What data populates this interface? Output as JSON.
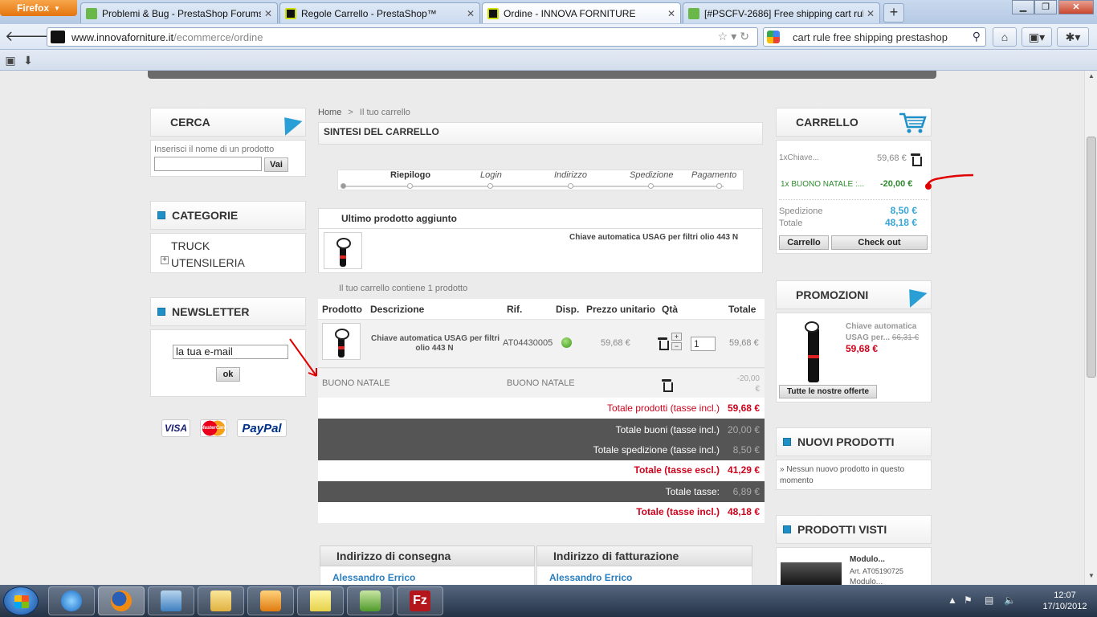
{
  "browser": {
    "menu_button": "Firefox",
    "tabs": [
      {
        "label": "Problemi & Bug - PrestaShop Forums",
        "icon": "prestashop-icon",
        "active": false
      },
      {
        "label": "Regole Carrello - PrestaShop™",
        "icon": "innova-icon",
        "active": false
      },
      {
        "label": "Ordine - INNOVA FORNITURE",
        "icon": "innova-icon",
        "active": true
      },
      {
        "label": "[#PSCFV-2686] Free shipping cart rule...",
        "icon": "prestashop-icon",
        "active": false
      }
    ],
    "url_domain": "www.innovaforniture.it",
    "url_path": "/ecommerce/ordine",
    "search_text": "cart rule free shipping prestashop"
  },
  "sidebar": {
    "search": {
      "title": "CERCA",
      "placeholder": "Inserisci il nome di un prodotto",
      "button": "Vai"
    },
    "categories": {
      "title": "CATEGORIE",
      "items": [
        "TRUCK",
        "UTENSILERIA"
      ]
    },
    "newsletter": {
      "title": "NEWSLETTER",
      "input_value": "la tua e-mail",
      "button": "ok"
    },
    "payments": [
      "VISA",
      "MasterCard",
      "PayPal"
    ]
  },
  "main": {
    "breadcrumb": {
      "home": "Home",
      "sep": ">",
      "current": "Il tuo carrello"
    },
    "title": "SINTESI DEL CARRELLO",
    "steps": [
      "Riepilogo",
      "Login",
      "Indirizzo",
      "Spedizione",
      "Pagamento"
    ],
    "last_added": {
      "title": "Ultimo prodotto aggiunto",
      "product": "Chiave automatica USAG per filtri olio 443 N"
    },
    "cart_count": "Il tuo carrello contiene 1 prodotto",
    "columns": [
      "Prodotto",
      "Descrizione",
      "Rif.",
      "Disp.",
      "Prezzo unitario",
      "Qtà",
      "Totale"
    ],
    "product_row": {
      "description_line1": "Chiave automatica USAG per filtri",
      "description_line2": "olio 443 N",
      "ref": "AT04430005",
      "unit_price": "59,68 €",
      "qty": "1",
      "total": "59,68 €"
    },
    "voucher_row": {
      "name": "BUONO NATALE",
      "name2": "BUONO NATALE",
      "value_line1": "-20,00",
      "value_line2": "€"
    },
    "totals": {
      "products_label": "Totale prodotti (tasse incl.)",
      "products_value": "59,68 €",
      "vouchers_label": "Totale buoni (tasse incl.)",
      "vouchers_value": "20,00 €",
      "shipping_label": "Totale spedizione (tasse incl.)",
      "shipping_value": "8,50 €",
      "excl_label": "Totale (tasse escl.)",
      "excl_value": "41,29 €",
      "tax_label": "Totale tasse:",
      "tax_value": "6,89 €",
      "incl_label": "Totale (tasse incl.)",
      "incl_value": "48,18 €"
    },
    "addresses": {
      "delivery_title": "Indirizzo di consegna",
      "delivery_name": "Alessandro Errico",
      "billing_title": "Indirizzo di fatturazione",
      "billing_name": "Alessandro Errico"
    }
  },
  "right": {
    "cart": {
      "title": "CARRELLO",
      "item_qty_name": "1xChiave...",
      "item_price": "59,68 €",
      "voucher_label": "1x BUONO NATALE :...",
      "voucher_value": "-20,00 €",
      "shipping_label": "Spedizione",
      "shipping_value": "8,50 €",
      "total_label": "Totale",
      "total_value": "48,18 €",
      "btn_cart": "Carrello",
      "btn_checkout": "Check out"
    },
    "promo": {
      "title": "PROMOZIONI",
      "name_line1": "Chiave automatica",
      "name_line2": "USAG per...",
      "old_price": "66,31 €",
      "price": "59,68 €",
      "btn": "Tutte le nostre offerte"
    },
    "new_products": {
      "title": "NUOVI PRODOTTI",
      "text_line1": "» Nessun nuovo prodotto in questo",
      "text_line2": "momento"
    },
    "viewed": {
      "title": "PRODOTTI VISTI",
      "name": "Modulo...",
      "ref": "Art. AT05190725",
      "name2": "Modulo..."
    }
  },
  "taskbar": {
    "time": "12:07",
    "date": "17/10/2012"
  },
  "colors": {
    "accent_blue": "#1e8fc7",
    "price_red": "#d0021b",
    "voucher_green": "#2c8a2c",
    "total_blue": "#3aa6d8",
    "annotation_red": "#e00000"
  }
}
